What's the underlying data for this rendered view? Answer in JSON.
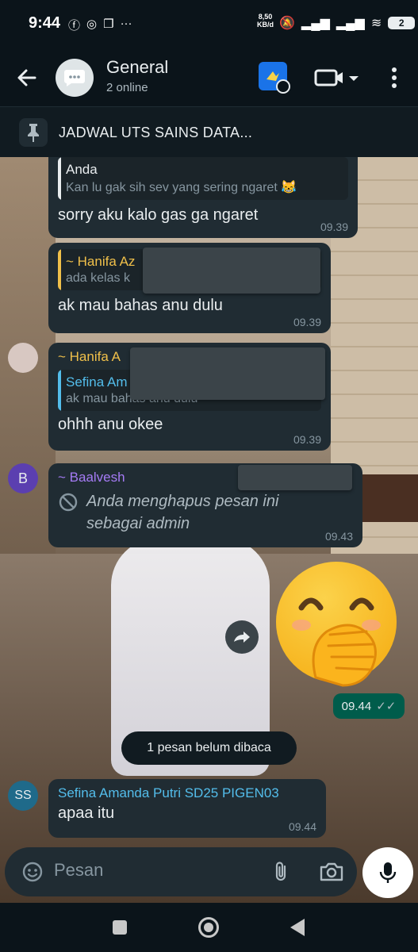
{
  "status_bar": {
    "time": "9:44",
    "net_speed_value": "8,50",
    "net_speed_unit": "KB/d",
    "battery": "2"
  },
  "header": {
    "title": "General",
    "subtitle": "2 online"
  },
  "pinned": {
    "text": "JADWAL UTS SAINS DATA..."
  },
  "messages": [
    {
      "quote_name": "Anda",
      "quote_text": "Kan lu gak sih sev yang sering ngaret 😹",
      "text": "sorry aku kalo gas ga ngaret",
      "time": "09.39"
    },
    {
      "quote_name": "~ Hanifa Az",
      "quote_text": "ada kelas k",
      "text": "ak mau bahas anu dulu",
      "time": "09.39"
    },
    {
      "sender": "~ Hanifa A",
      "quote_name": "Sefina Am",
      "quote_text": "ak mau bahas anu dulu",
      "text": "ohhh anu okee",
      "time": "09.39"
    },
    {
      "avatar": "B",
      "sender": "~ Baalvesh",
      "sender_suffix": "+",
      "text": "Anda menghapus pesan ini sebagai admin",
      "time": "09.43"
    },
    {
      "avatar": "SS",
      "sender": "Sefina Amanda Putri SD25 PIGEN03",
      "text": "apaa itu",
      "time": "09.44"
    }
  ],
  "sent_sticker": {
    "icon": "hand-over-mouth-emoji",
    "time": "09.44"
  },
  "unread_label": "1 pesan belum dibaca",
  "input": {
    "placeholder": "Pesan"
  },
  "colors": {
    "background": "#0b141a",
    "bubble": "#202c33",
    "sent_bubble": "#005c4b",
    "accent_blue": "#53bdeb",
    "accent_yellow": "#f0c04a",
    "accent_purple": "#a57bf5"
  }
}
